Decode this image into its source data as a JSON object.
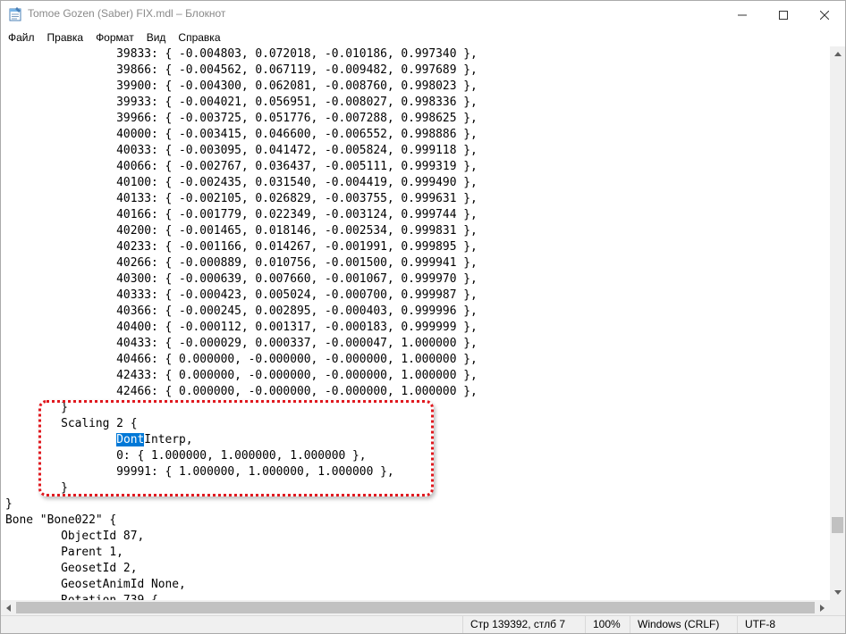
{
  "window": {
    "title": "Tomoe Gozen (Saber) FIX.mdl – Блокнот",
    "icon": "notepad-icon"
  },
  "menu": {
    "items": [
      {
        "label": "Файл"
      },
      {
        "label": "Правка"
      },
      {
        "label": "Формат"
      },
      {
        "label": "Вид"
      },
      {
        "label": "Справка"
      }
    ]
  },
  "editor": {
    "lines": [
      "\t\t39833: { -0.004803, 0.072018, -0.010186, 0.997340 },",
      "\t\t39866: { -0.004562, 0.067119, -0.009482, 0.997689 },",
      "\t\t39900: { -0.004300, 0.062081, -0.008760, 0.998023 },",
      "\t\t39933: { -0.004021, 0.056951, -0.008027, 0.998336 },",
      "\t\t39966: { -0.003725, 0.051776, -0.007288, 0.998625 },",
      "\t\t40000: { -0.003415, 0.046600, -0.006552, 0.998886 },",
      "\t\t40033: { -0.003095, 0.041472, -0.005824, 0.999118 },",
      "\t\t40066: { -0.002767, 0.036437, -0.005111, 0.999319 },",
      "\t\t40100: { -0.002435, 0.031540, -0.004419, 0.999490 },",
      "\t\t40133: { -0.002105, 0.026829, -0.003755, 0.999631 },",
      "\t\t40166: { -0.001779, 0.022349, -0.003124, 0.999744 },",
      "\t\t40200: { -0.001465, 0.018146, -0.002534, 0.999831 },",
      "\t\t40233: { -0.001166, 0.014267, -0.001991, 0.999895 },",
      "\t\t40266: { -0.000889, 0.010756, -0.001500, 0.999941 },",
      "\t\t40300: { -0.000639, 0.007660, -0.001067, 0.999970 },",
      "\t\t40333: { -0.000423, 0.005024, -0.000700, 0.999987 },",
      "\t\t40366: { -0.000245, 0.002895, -0.000403, 0.999996 },",
      "\t\t40400: { -0.000112, 0.001317, -0.000183, 0.999999 },",
      "\t\t40433: { -0.000029, 0.000337, -0.000047, 1.000000 },",
      "\t\t40466: { 0.000000, -0.000000, -0.000000, 1.000000 },",
      "\t\t42433: { 0.000000, -0.000000, -0.000000, 1.000000 },",
      "\t\t42466: { 0.000000, -0.000000, -0.000000, 1.000000 },",
      "\t}",
      "\tScaling 2 {",
      "\t\tDontInterp,",
      "\t\t0: { 1.000000, 1.000000, 1.000000 },",
      "\t\t99991: { 1.000000, 1.000000, 1.000000 },",
      "\t}",
      "}",
      "Bone \"Bone022\" {",
      "\tObjectId 87,",
      "\tParent 1,",
      "\tGeosetId 2,",
      "\tGeosetAnimId None,",
      "\tRotation 739 {"
    ],
    "selection": {
      "line_index": 24,
      "text": "Dont"
    }
  },
  "statusbar": {
    "position": "Стр 139392, стлб 7",
    "zoom": "100%",
    "line_endings": "Windows (CRLF)",
    "encoding": "UTF-8"
  }
}
